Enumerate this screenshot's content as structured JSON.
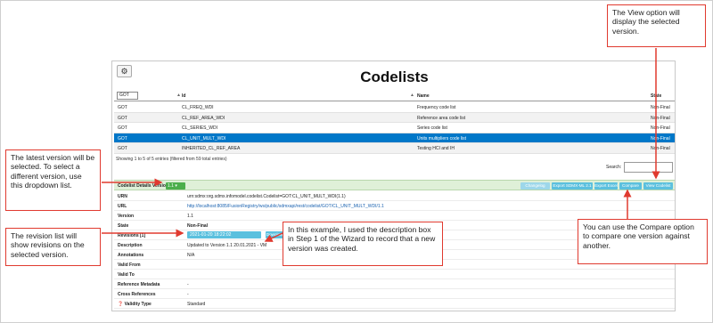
{
  "page": {
    "title": "Codelists",
    "settings_icon": "⚙"
  },
  "table": {
    "filter_value": "GOT",
    "headers": {
      "id": "Id",
      "name": "Name",
      "state": "State"
    },
    "rows": [
      {
        "agency": "GOT",
        "id": "CL_FREQ_WDI",
        "name": "Frequency code list",
        "state": "Non-Final"
      },
      {
        "agency": "GOT",
        "id": "CL_REF_AREA_WDI",
        "name": "Reference area code list",
        "state": "Non-Final"
      },
      {
        "agency": "GOT",
        "id": "CL_SERIES_WDI",
        "name": "Series code list",
        "state": "Non-Final"
      },
      {
        "agency": "GOT",
        "id": "CL_UNIT_MULT_WDI",
        "name": "Units multipliers code list",
        "state": "Non-Final"
      },
      {
        "agency": "GOT",
        "id": "INHERITED_CL_REF_AREA",
        "name": "Testing HCI and IH",
        "state": "Non-Final"
      }
    ],
    "selected_row_index": 3,
    "info": "Showing 1 to 5 of 5 entries (filtered from 59 total entries)",
    "search_label": "Search:"
  },
  "details": {
    "title": "Codelist Details Version",
    "version_value": "1.1",
    "buttons": {
      "changelog": "Changelog",
      "export_sdmx": "Export SDMX-ML 2.1",
      "export_excel": "Export Excel",
      "compare": "Compare",
      "view": "View Codelist"
    },
    "fields": {
      "urn_label": "URN",
      "urn_value": "urn:sdmx:org.sdmx.infomodel.codelist.Codelist=GOT:CL_UNIT_MULT_WDI(1.1)",
      "url_label": "URL",
      "url_value": "http://localhost:8085/FusionRegistry/ws/public/sdmxapi/rest/codelist/GOT/CL_UNIT_MULT_WDI/1.1",
      "version_label": "Version",
      "version_value": "1.1",
      "state_label": "State",
      "state_value": "Non-Final",
      "revisions_label": "Revisions [1]",
      "revisions_value": "2021-01-20 18:22:02",
      "download_label": "Download",
      "description_label": "Description",
      "description_value": "Updated to Version 1.1 20.01.2021 - VM",
      "annotations_label": "Annotations",
      "annotations_value": "N/A",
      "valid_from_label": "Valid From",
      "valid_from_value": "",
      "valid_to_label": "Valid To",
      "valid_to_value": "",
      "ref_metadata_label": "Reference Metadata",
      "ref_metadata_value": "-",
      "cross_ref_label": "Cross References",
      "cross_ref_value": "-",
      "validity_label": "Validity Type",
      "validity_value": "Standard"
    }
  },
  "callouts": {
    "view": "The View option will display the selected version.",
    "latest": "The latest version will be selected. To select a different version, use this dropdown list.",
    "revision": "The revision list will show revisions on the selected version.",
    "description": "In this example, I used the description box in Step 1 of the Wizard to record that a new version was created.",
    "compare": "You can use the Compare option to compare one version against another."
  },
  "colors": {
    "accent": "#e03a2f",
    "selected_row": "#0077c8",
    "button": "#5bc0de",
    "details_bar": "#dff0d8"
  }
}
